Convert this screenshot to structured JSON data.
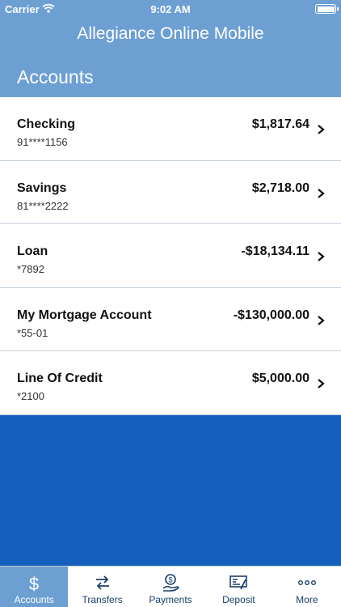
{
  "status": {
    "carrier": "Carrier",
    "time": "9:02 AM",
    "battery_level": 1.0
  },
  "header": {
    "app_title": "Allegiance Online Mobile",
    "section_title": "Accounts"
  },
  "accounts": [
    {
      "name": "Checking",
      "number": "91****1156",
      "balance": "$1,817.64"
    },
    {
      "name": "Savings",
      "number": "81****2222",
      "balance": "$2,718.00"
    },
    {
      "name": "Loan",
      "number": "*7892",
      "balance": "-$18,134.11"
    },
    {
      "name": "My Mortgage Account",
      "number": "*55-01",
      "balance": "-$130,000.00"
    },
    {
      "name": "Line Of Credit",
      "number": "*2100",
      "balance": "$5,000.00"
    }
  ],
  "tabs": [
    {
      "label": "Accounts",
      "icon": "dollar-icon",
      "active": true
    },
    {
      "label": "Transfers",
      "icon": "transfer-arrows-icon",
      "active": false
    },
    {
      "label": "Payments",
      "icon": "payments-hand-icon",
      "active": false
    },
    {
      "label": "Deposit",
      "icon": "check-deposit-icon",
      "active": false
    },
    {
      "label": "More",
      "icon": "more-dots-icon",
      "active": false
    }
  ],
  "colors": {
    "header_bg": "#6d9fd3",
    "body_bg": "#1560bd",
    "tab_active_bg": "#6d9fd3",
    "tab_text": "#1a3f6b"
  }
}
